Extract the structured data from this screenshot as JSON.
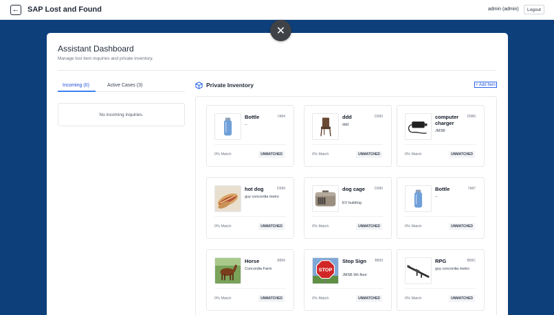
{
  "app": {
    "title": "SAP Lost and Found",
    "user": "admin (admin)",
    "logout_label": "Logout"
  },
  "dashboard": {
    "title": "Assistant Dashboard",
    "subtitle": "Manage lost item inquiries and private inventory.",
    "tabs": [
      {
        "label": "Incoming (0)",
        "active": true
      },
      {
        "label": "Active Cases (3)",
        "active": false
      }
    ],
    "empty_message": "No incoming inquiries."
  },
  "inventory": {
    "title": "Private Inventory",
    "add_label": "+ Add Item",
    "items": [
      {
        "name": "Bottle",
        "code": "7A84",
        "desc": "--",
        "icon": "water-bottle-icon",
        "match": "0% Match",
        "status": "UNMATCHED"
      },
      {
        "name": "ddd",
        "code": "D583",
        "desc": "ddd",
        "icon": "chair-icon",
        "match": "0% Match",
        "status": "UNMATCHED"
      },
      {
        "name": "computer charger",
        "code": "D5B6",
        "desc": "JMSB",
        "icon": "charger-icon",
        "match": "0% Match",
        "status": "UNMATCHED"
      },
      {
        "name": "hot dog",
        "code": "D589",
        "desc": "guy concordia metro",
        "icon": "hot-dog-icon",
        "match": "0% Match",
        "status": "UNMATCHED"
      },
      {
        "name": "dog cage",
        "code": "D580",
        "desc": "EV building",
        "icon": "pet-carrier-icon",
        "match": "0% Match",
        "status": "UNMATCHED"
      },
      {
        "name": "Bottle",
        "code": "7A87",
        "desc": "--",
        "icon": "water-bottle-icon",
        "match": "0% Match",
        "status": "UNMATCHED"
      },
      {
        "name": "Horse",
        "code": "B896",
        "desc": "Concordia Farm",
        "icon": "horse-icon",
        "match": "0% Match",
        "status": "UNMATCHED"
      },
      {
        "name": "Stop Sign",
        "code": "B899",
        "desc": "JMSB 9th floor",
        "icon": "stop-sign-icon",
        "match": "0% Match",
        "status": "UNMATCHED"
      },
      {
        "name": "RPG",
        "code": "B89C",
        "desc": "guy concordia metro",
        "icon": "rpg-icon",
        "match": "0% Match",
        "status": "UNMATCHED"
      }
    ]
  },
  "colors": {
    "background": "#0d3f7a",
    "accent": "#2563eb",
    "badge_bg": "#f3f4f6"
  }
}
